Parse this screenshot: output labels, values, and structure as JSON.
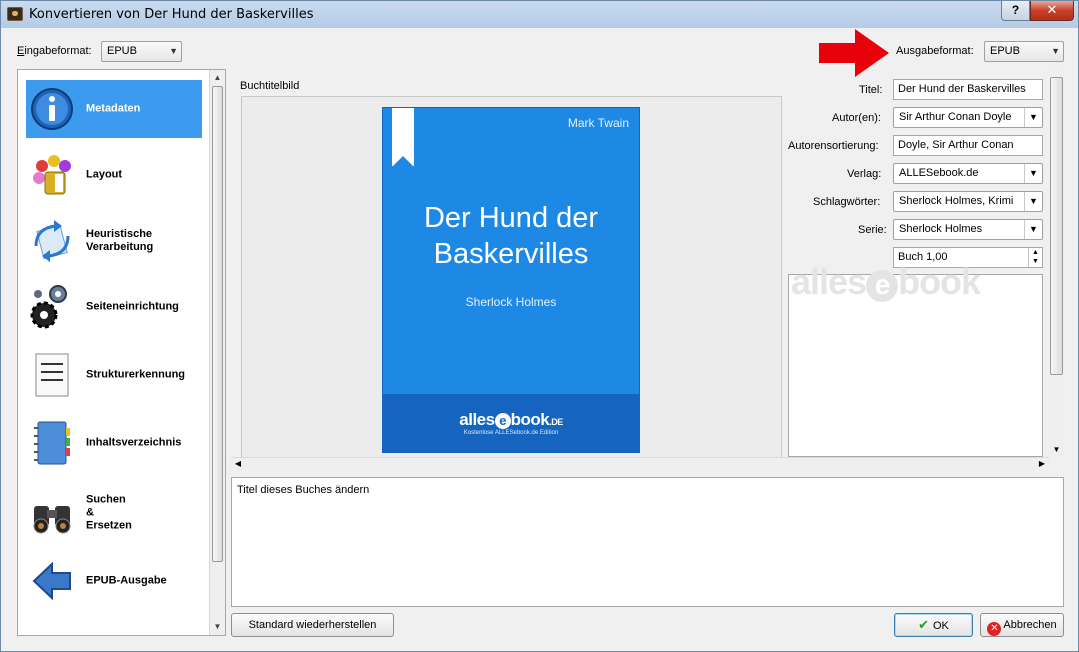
{
  "window": {
    "title": "Konvertieren von Der Hund der Baskervilles",
    "help_label": "?",
    "close_label": "✕"
  },
  "input_format": {
    "label": "Eingabeformat:",
    "value": "EPUB"
  },
  "output_format": {
    "label": "Ausgabeformat:",
    "value": "EPUB"
  },
  "sidebar": {
    "items": [
      {
        "label": "Metadaten",
        "icon": "info-icon",
        "active": true
      },
      {
        "label": "Layout",
        "icon": "paint-palette-icon"
      },
      {
        "label": "Heuristische Verarbeitung",
        "icon": "heuristics-arrows-icon"
      },
      {
        "label": "Seiteneinrichtung",
        "icon": "gears-icon"
      },
      {
        "label": "Strukturerkennung",
        "icon": "document-lines-icon"
      },
      {
        "label": "Inhaltsverzeichnis",
        "icon": "notebook-icon"
      },
      {
        "label": "Suchen & Ersetzen",
        "icon": "binoculars-icon"
      },
      {
        "label": "EPUB-Ausgabe",
        "icon": "left-arrow-icon"
      }
    ]
  },
  "cover": {
    "section_label": "Buchtitelbild",
    "author": "Mark Twain",
    "title": "Der Hund der Baskervilles",
    "subtitle": "Sherlock Holmes",
    "logo": "alles",
    "logo_e": "e",
    "logo_book": "book",
    "logo_de": ".DE",
    "tagline": "Kostenlose ALLESebook.de Edition"
  },
  "metadata": {
    "title_label": "Titel:",
    "title_value": "Der Hund der Baskervilles",
    "authors_label": "Autor(en):",
    "authors_value": "Sir Arthur Conan Doyle",
    "author_sort_label": "Autorensortierung:",
    "author_sort_value": "Doyle, Sir Arthur Conan",
    "publisher_label": "Verlag:",
    "publisher_value": "ALLESebook.de",
    "tags_label": "Schlagwörter:",
    "tags_value": "Sherlock Holmes, Krimi",
    "series_label": "Serie:",
    "series_value": "Sherlock Holmes",
    "series_index_value": "Buch 1,00"
  },
  "watermark": {
    "text_pre": "alles",
    "text_e": "e",
    "text_post": "book"
  },
  "help_text": "Titel dieses Buches ändern",
  "buttons": {
    "restore_defaults": "Standard wiederherstellen",
    "ok": "OK",
    "cancel": "Abbrechen"
  },
  "colors": {
    "accent": "#3d9bef",
    "cover_blue": "#1e88e5",
    "arrow_red": "#e8000b"
  }
}
